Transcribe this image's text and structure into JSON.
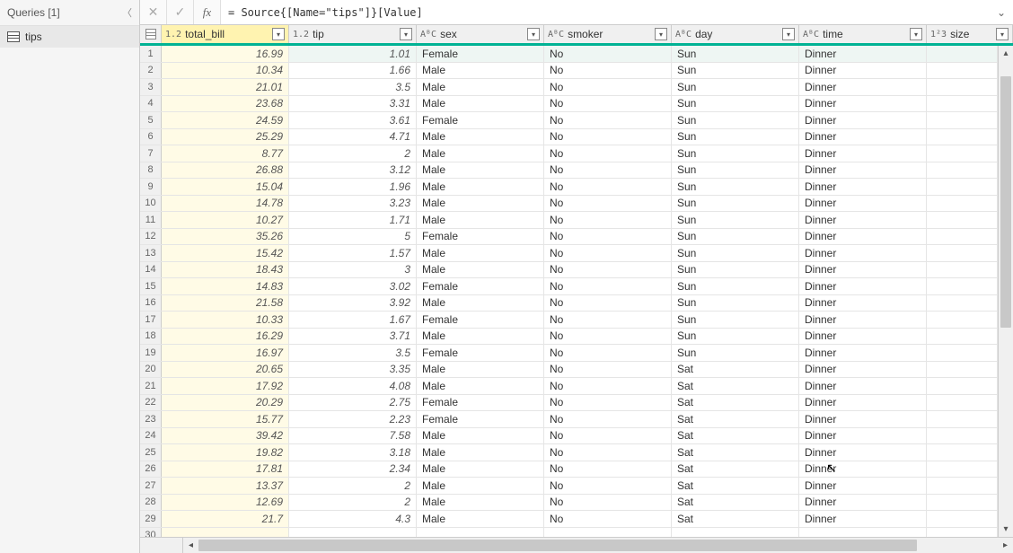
{
  "queries": {
    "title": "Queries [1]",
    "items": [
      {
        "name": "tips"
      }
    ]
  },
  "formula": {
    "text": "= Source{[Name=\"tips\"]}[Value]"
  },
  "columns": [
    {
      "key": "total_bill",
      "label": "total_bill",
      "type": "1.2",
      "cls": "c-total",
      "numeric": true,
      "selected": true
    },
    {
      "key": "tip",
      "label": "tip",
      "type": "1.2",
      "cls": "c-tip",
      "numeric": true
    },
    {
      "key": "sex",
      "label": "sex",
      "type": "ABC",
      "cls": "c-sex",
      "numeric": false
    },
    {
      "key": "smoker",
      "label": "smoker",
      "type": "ABC",
      "cls": "c-smoker",
      "numeric": false
    },
    {
      "key": "day",
      "label": "day",
      "type": "ABC",
      "cls": "c-day",
      "numeric": false
    },
    {
      "key": "time",
      "label": "time",
      "type": "ABC",
      "cls": "c-time",
      "numeric": false
    },
    {
      "key": "size",
      "label": "size",
      "type": "123",
      "cls": "c-size",
      "numeric": true
    }
  ],
  "rows": [
    {
      "n": 1,
      "total_bill": "16.99",
      "tip": "1.01",
      "sex": "Female",
      "smoker": "No",
      "day": "Sun",
      "time": "Dinner"
    },
    {
      "n": 2,
      "total_bill": "10.34",
      "tip": "1.66",
      "sex": "Male",
      "smoker": "No",
      "day": "Sun",
      "time": "Dinner"
    },
    {
      "n": 3,
      "total_bill": "21.01",
      "tip": "3.5",
      "sex": "Male",
      "smoker": "No",
      "day": "Sun",
      "time": "Dinner"
    },
    {
      "n": 4,
      "total_bill": "23.68",
      "tip": "3.31",
      "sex": "Male",
      "smoker": "No",
      "day": "Sun",
      "time": "Dinner"
    },
    {
      "n": 5,
      "total_bill": "24.59",
      "tip": "3.61",
      "sex": "Female",
      "smoker": "No",
      "day": "Sun",
      "time": "Dinner"
    },
    {
      "n": 6,
      "total_bill": "25.29",
      "tip": "4.71",
      "sex": "Male",
      "smoker": "No",
      "day": "Sun",
      "time": "Dinner"
    },
    {
      "n": 7,
      "total_bill": "8.77",
      "tip": "2",
      "sex": "Male",
      "smoker": "No",
      "day": "Sun",
      "time": "Dinner"
    },
    {
      "n": 8,
      "total_bill": "26.88",
      "tip": "3.12",
      "sex": "Male",
      "smoker": "No",
      "day": "Sun",
      "time": "Dinner"
    },
    {
      "n": 9,
      "total_bill": "15.04",
      "tip": "1.96",
      "sex": "Male",
      "smoker": "No",
      "day": "Sun",
      "time": "Dinner"
    },
    {
      "n": 10,
      "total_bill": "14.78",
      "tip": "3.23",
      "sex": "Male",
      "smoker": "No",
      "day": "Sun",
      "time": "Dinner"
    },
    {
      "n": 11,
      "total_bill": "10.27",
      "tip": "1.71",
      "sex": "Male",
      "smoker": "No",
      "day": "Sun",
      "time": "Dinner"
    },
    {
      "n": 12,
      "total_bill": "35.26",
      "tip": "5",
      "sex": "Female",
      "smoker": "No",
      "day": "Sun",
      "time": "Dinner"
    },
    {
      "n": 13,
      "total_bill": "15.42",
      "tip": "1.57",
      "sex": "Male",
      "smoker": "No",
      "day": "Sun",
      "time": "Dinner"
    },
    {
      "n": 14,
      "total_bill": "18.43",
      "tip": "3",
      "sex": "Male",
      "smoker": "No",
      "day": "Sun",
      "time": "Dinner"
    },
    {
      "n": 15,
      "total_bill": "14.83",
      "tip": "3.02",
      "sex": "Female",
      "smoker": "No",
      "day": "Sun",
      "time": "Dinner"
    },
    {
      "n": 16,
      "total_bill": "21.58",
      "tip": "3.92",
      "sex": "Male",
      "smoker": "No",
      "day": "Sun",
      "time": "Dinner"
    },
    {
      "n": 17,
      "total_bill": "10.33",
      "tip": "1.67",
      "sex": "Female",
      "smoker": "No",
      "day": "Sun",
      "time": "Dinner"
    },
    {
      "n": 18,
      "total_bill": "16.29",
      "tip": "3.71",
      "sex": "Male",
      "smoker": "No",
      "day": "Sun",
      "time": "Dinner"
    },
    {
      "n": 19,
      "total_bill": "16.97",
      "tip": "3.5",
      "sex": "Female",
      "smoker": "No",
      "day": "Sun",
      "time": "Dinner"
    },
    {
      "n": 20,
      "total_bill": "20.65",
      "tip": "3.35",
      "sex": "Male",
      "smoker": "No",
      "day": "Sat",
      "time": "Dinner"
    },
    {
      "n": 21,
      "total_bill": "17.92",
      "tip": "4.08",
      "sex": "Male",
      "smoker": "No",
      "day": "Sat",
      "time": "Dinner"
    },
    {
      "n": 22,
      "total_bill": "20.29",
      "tip": "2.75",
      "sex": "Female",
      "smoker": "No",
      "day": "Sat",
      "time": "Dinner"
    },
    {
      "n": 23,
      "total_bill": "15.77",
      "tip": "2.23",
      "sex": "Female",
      "smoker": "No",
      "day": "Sat",
      "time": "Dinner"
    },
    {
      "n": 24,
      "total_bill": "39.42",
      "tip": "7.58",
      "sex": "Male",
      "smoker": "No",
      "day": "Sat",
      "time": "Dinner"
    },
    {
      "n": 25,
      "total_bill": "19.82",
      "tip": "3.18",
      "sex": "Male",
      "smoker": "No",
      "day": "Sat",
      "time": "Dinner"
    },
    {
      "n": 26,
      "total_bill": "17.81",
      "tip": "2.34",
      "sex": "Male",
      "smoker": "No",
      "day": "Sat",
      "time": "Dinner"
    },
    {
      "n": 27,
      "total_bill": "13.37",
      "tip": "2",
      "sex": "Male",
      "smoker": "No",
      "day": "Sat",
      "time": "Dinner"
    },
    {
      "n": 28,
      "total_bill": "12.69",
      "tip": "2",
      "sex": "Male",
      "smoker": "No",
      "day": "Sat",
      "time": "Dinner"
    },
    {
      "n": 29,
      "total_bill": "21.7",
      "tip": "4.3",
      "sex": "Male",
      "smoker": "No",
      "day": "Sat",
      "time": "Dinner"
    },
    {
      "n": 30,
      "total_bill": "",
      "tip": "",
      "sex": "",
      "smoker": "",
      "day": "",
      "time": ""
    }
  ]
}
